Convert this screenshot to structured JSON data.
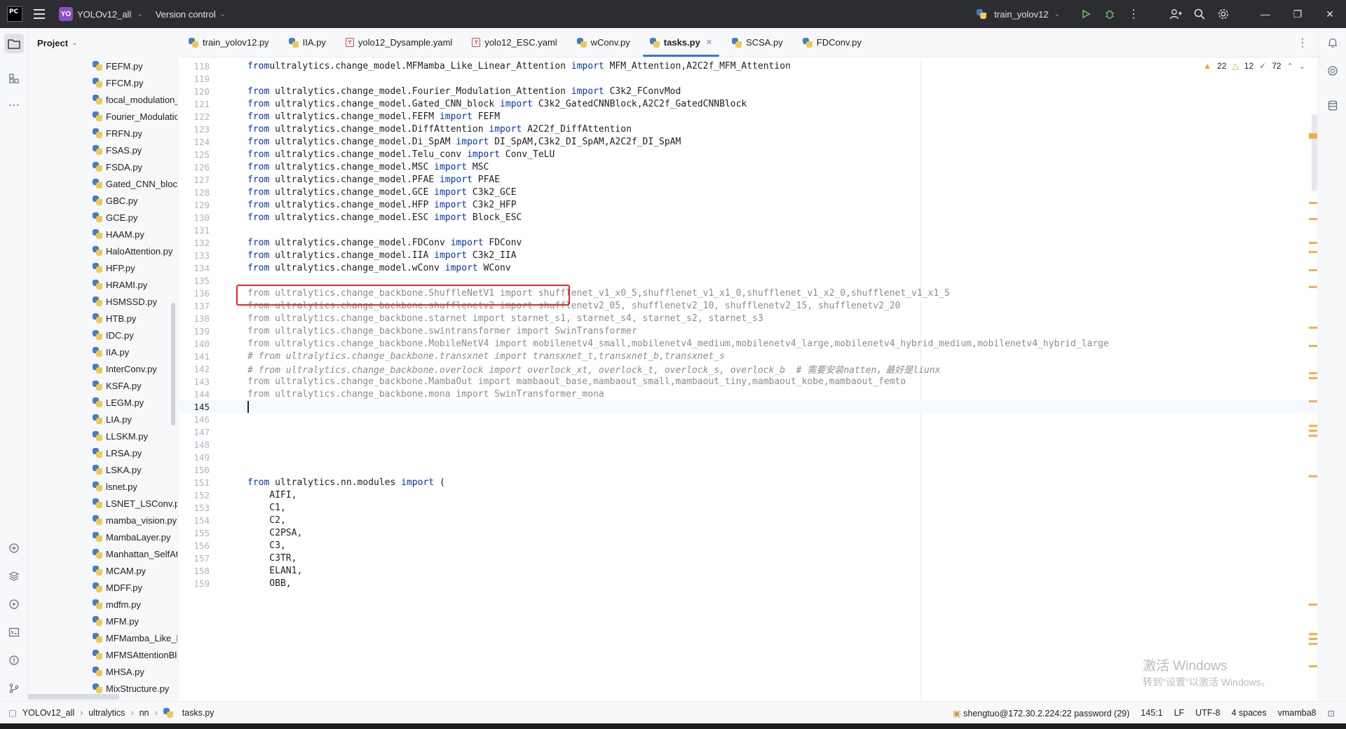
{
  "titlebar": {
    "logo": "PC",
    "project_badge": "YO",
    "project_name": "YOLOv12_all",
    "version_control": "Version control",
    "run_config": "train_yolov12"
  },
  "sidebar": {
    "title": "Project",
    "files": [
      "FEFM.py",
      "FFCM.py",
      "focal_modulation_",
      "Fourier_Modulatic",
      "FRFN.py",
      "FSAS.py",
      "FSDA.py",
      "Gated_CNN_block",
      "GBC.py",
      "GCE.py",
      "HAAM.py",
      "HaloAttention.py",
      "HFP.py",
      "HRAMI.py",
      "HSMSSD.py",
      "HTB.py",
      "IDC.py",
      "IIA.py",
      "InterConv.py",
      "KSFA.py",
      "LEGM.py",
      "LIA.py",
      "LLSKM.py",
      "LRSA.py",
      "LSKA.py",
      "lsnet.py",
      "LSNET_LSConv.py",
      "mamba_vision.py",
      "MambaLayer.py",
      "Manhattan_SelfAtt",
      "MCAM.py",
      "MDFF.py",
      "mdfm.py",
      "MFM.py",
      "MFMamba_Like_L",
      "MFMSAttentionBlc",
      "MHSA.py",
      "MixStructure.py"
    ]
  },
  "tabs": [
    {
      "label": "train_yolov12.py",
      "type": "py"
    },
    {
      "label": "IIA.py",
      "type": "py"
    },
    {
      "label": "yolo12_Dysample.yaml",
      "type": "yaml"
    },
    {
      "label": "yolo12_ESC.yaml",
      "type": "yaml"
    },
    {
      "label": "wConv.py",
      "type": "py"
    },
    {
      "label": "tasks.py",
      "type": "py",
      "active": true
    },
    {
      "label": "SCSA.py",
      "type": "py"
    },
    {
      "label": "FDConv.py",
      "type": "py"
    }
  ],
  "inspections": {
    "warnings": "22",
    "weak_warnings": "12",
    "ok": "72"
  },
  "editor": {
    "current_line": "145",
    "lines": [
      {
        "n": "118",
        "parts": [
          [
            "kw",
            "from"
          ],
          [
            "",
            "ultralytics.change_model.MFMamba_Like_Linear_Attention "
          ],
          [
            "kw",
            "import"
          ],
          [
            "",
            " MFM_Attention,A2C2f_MFM_Attention"
          ]
        ]
      },
      {
        "n": "119",
        "parts": []
      },
      {
        "n": "120",
        "parts": [
          [
            "kw",
            "from"
          ],
          [
            "",
            " ultralytics.change_model.Fourier_Modulation_Attention "
          ],
          [
            "kw",
            "import"
          ],
          [
            "",
            " C3k2_FConvMod"
          ]
        ]
      },
      {
        "n": "121",
        "parts": [
          [
            "kw",
            "from"
          ],
          [
            "",
            " ultralytics.change_model.Gated_CNN_block "
          ],
          [
            "kw",
            "import"
          ],
          [
            "",
            " C3k2_GatedCNNBlock,A2C2f_GatedCNNBlock"
          ]
        ]
      },
      {
        "n": "122",
        "parts": [
          [
            "kw",
            "from"
          ],
          [
            "",
            " ultralytics.change_model.FEFM "
          ],
          [
            "kw",
            "import"
          ],
          [
            "",
            " FEFM"
          ]
        ]
      },
      {
        "n": "123",
        "parts": [
          [
            "kw",
            "from"
          ],
          [
            "",
            " ultralytics.change_model.DiffAttention "
          ],
          [
            "kw",
            "import"
          ],
          [
            "",
            " A2C2f_DiffAttention"
          ]
        ]
      },
      {
        "n": "124",
        "parts": [
          [
            "kw",
            "from"
          ],
          [
            "",
            " ultralytics.change_model.Di_SpAM "
          ],
          [
            "kw",
            "import"
          ],
          [
            "",
            " DI_SpAM,C3k2_DI_SpAM,A2C2f_DI_SpAM"
          ]
        ]
      },
      {
        "n": "125",
        "parts": [
          [
            "kw",
            "from"
          ],
          [
            "",
            " ultralytics.change_model.Telu_conv "
          ],
          [
            "kw",
            "import"
          ],
          [
            "",
            " Conv_TeLU"
          ]
        ]
      },
      {
        "n": "126",
        "parts": [
          [
            "kw",
            "from"
          ],
          [
            "",
            " ultralytics.change_model.MSC "
          ],
          [
            "kw",
            "import"
          ],
          [
            "",
            " MSC"
          ]
        ]
      },
      {
        "n": "127",
        "parts": [
          [
            "kw",
            "from"
          ],
          [
            "",
            " ultralytics.change_model.PFAE "
          ],
          [
            "kw",
            "import"
          ],
          [
            "",
            " PFAE"
          ]
        ]
      },
      {
        "n": "128",
        "parts": [
          [
            "kw",
            "from"
          ],
          [
            "",
            " ultralytics.change_model.GCE "
          ],
          [
            "kw",
            "import"
          ],
          [
            "",
            " C3k2_GCE"
          ]
        ]
      },
      {
        "n": "129",
        "parts": [
          [
            "kw",
            "from"
          ],
          [
            "",
            " ultralytics.change_model.HFP "
          ],
          [
            "kw",
            "import"
          ],
          [
            "",
            " C3k2_HFP"
          ]
        ]
      },
      {
        "n": "130",
        "parts": [
          [
            "kw",
            "from"
          ],
          [
            "",
            " ultralytics.change_model.ESC "
          ],
          [
            "kw",
            "import"
          ],
          [
            "",
            " Block_ESC"
          ]
        ]
      },
      {
        "n": "131",
        "parts": []
      },
      {
        "n": "132",
        "parts": [
          [
            "kw",
            "from"
          ],
          [
            "",
            " ultralytics.change_model.FDConv "
          ],
          [
            "kw",
            "import"
          ],
          [
            "",
            " FDConv"
          ]
        ]
      },
      {
        "n": "133",
        "parts": [
          [
            "kw",
            "from"
          ],
          [
            "",
            " ultralytics.change_model.IIA "
          ],
          [
            "kw",
            "import"
          ],
          [
            "",
            " C3k2_IIA"
          ]
        ]
      },
      {
        "n": "134",
        "parts": [
          [
            "kw",
            "from"
          ],
          [
            "",
            " ultralytics.change_model.wConv "
          ],
          [
            "kw",
            "import"
          ],
          [
            "",
            " WConv"
          ]
        ]
      },
      {
        "n": "135",
        "parts": []
      },
      {
        "n": "136",
        "parts": [
          [
            "dim",
            "from ultralytics.change_backbone.ShuffleNetV1 import shufflenet_v1_x0_5,shufflenet_v1_x1_0,shufflenet_v1_x2_0,shufflenet_v1_x1_5"
          ]
        ]
      },
      {
        "n": "137",
        "parts": [
          [
            "dim",
            "from ultralytics.change_backbone.shufflenetv2 import shufflenetv2_05, shufflenetv2_10, shufflenetv2_15, shufflenetv2_20"
          ]
        ]
      },
      {
        "n": "138",
        "parts": [
          [
            "dim",
            "from ultralytics.change_backbone.starnet import starnet_s1, starnet_s4, starnet_s2, starnet_s3"
          ]
        ]
      },
      {
        "n": "139",
        "parts": [
          [
            "dim",
            "from ultralytics.change_backbone.swintransformer import SwinTransformer"
          ]
        ]
      },
      {
        "n": "140",
        "parts": [
          [
            "dim",
            "from ultralytics.change_backbone.MobileNetV4 import mobilenetv4_small,mobilenetv4_medium,mobilenetv4_large,mobilenetv4_hybrid_medium,mobilenetv4_hybrid_large"
          ]
        ]
      },
      {
        "n": "141",
        "parts": [
          [
            "cm",
            "# from ultralytics.change_backbone.transxnet import transxnet_t,transxnet_b,transxnet_s"
          ]
        ]
      },
      {
        "n": "142",
        "parts": [
          [
            "cm",
            "# from ultralytics.change_backbone.overlock import overlock_xt, overlock_t, overlock_s, overlock_b  # 需要安装natten，最好是liunx"
          ]
        ]
      },
      {
        "n": "143",
        "parts": [
          [
            "dim",
            "from ultralytics.change_backbone.MambaOut import mambaout_base,mambaout_small,mambaout_tiny,mambaout_kobe,mambaout_femto"
          ]
        ]
      },
      {
        "n": "144",
        "parts": [
          [
            "dim",
            "from ultralytics.change_backbone.mona import SwinTransformer_mona"
          ]
        ]
      },
      {
        "n": "145",
        "parts": [
          [
            "cursor",
            ""
          ]
        ]
      },
      {
        "n": "146",
        "parts": []
      },
      {
        "n": "147",
        "parts": []
      },
      {
        "n": "148",
        "parts": []
      },
      {
        "n": "149",
        "parts": []
      },
      {
        "n": "150",
        "parts": []
      },
      {
        "n": "151",
        "parts": [
          [
            "kw",
            "from"
          ],
          [
            "",
            " ultralytics.nn.modules "
          ],
          [
            "kw",
            "import"
          ],
          [
            "",
            " ("
          ]
        ]
      },
      {
        "n": "152",
        "parts": [
          [
            "",
            "    AIFI,"
          ]
        ]
      },
      {
        "n": "153",
        "parts": [
          [
            "",
            "    C1,"
          ]
        ]
      },
      {
        "n": "154",
        "parts": [
          [
            "",
            "    C2,"
          ]
        ]
      },
      {
        "n": "155",
        "parts": [
          [
            "",
            "    C2PSA,"
          ]
        ]
      },
      {
        "n": "156",
        "parts": [
          [
            "",
            "    C3,"
          ]
        ]
      },
      {
        "n": "157",
        "parts": [
          [
            "",
            "    C3TR,"
          ]
        ]
      },
      {
        "n": "158",
        "parts": [
          [
            "",
            "    ELAN1,"
          ]
        ]
      },
      {
        "n": "159",
        "parts": [
          [
            "",
            "    OBB,"
          ]
        ]
      }
    ]
  },
  "watermark": {
    "line1": "激活 Windows",
    "line2": "转到\"设置\"以激活 Windows。"
  },
  "statusbar": {
    "crumbs": [
      "YOLOv12_all",
      "ultralytics",
      "nn",
      "tasks.py"
    ],
    "interpreter_host": "shengtuo@172.30.2.224:22 password (29)",
    "position": "145:1",
    "line_sep": "LF",
    "encoding": "UTF-8",
    "indent": "4 spaces",
    "env": "vmamba8"
  },
  "colors": {
    "accent": "#3574f0",
    "keyword": "#0033b3",
    "highlight_box": "#e5261f"
  }
}
